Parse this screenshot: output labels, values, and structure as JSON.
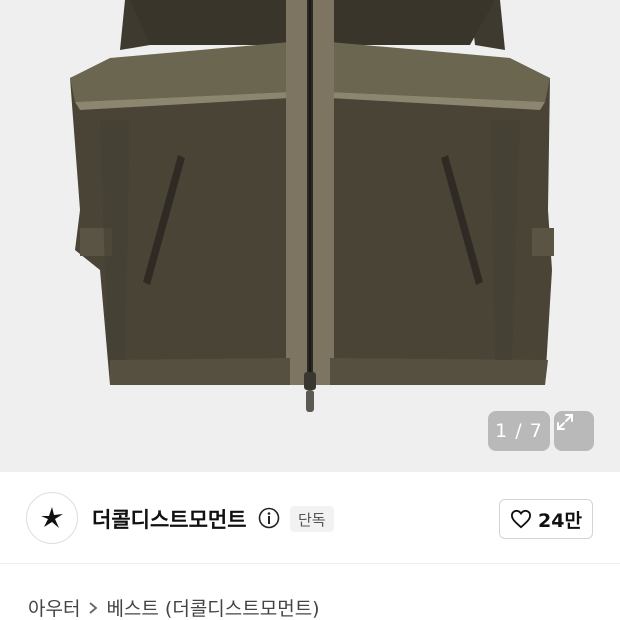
{
  "gallery": {
    "image_alt": "Brown zip-up utility vest",
    "counter": "1 / 7",
    "expand_icon": "expand-arrows-icon"
  },
  "shop": {
    "name": "더콜디스트모먼트",
    "logo_icon": "star-logo-icon",
    "info_icon": "info-circle-icon",
    "badge": "단독",
    "like_icon": "heart-outline-icon",
    "like_count": "24만"
  },
  "breadcrumb": {
    "items": [
      "아우터",
      "베스트 (더콜디스트모먼트)"
    ],
    "separator_icon": "chevron-right-icon"
  }
}
